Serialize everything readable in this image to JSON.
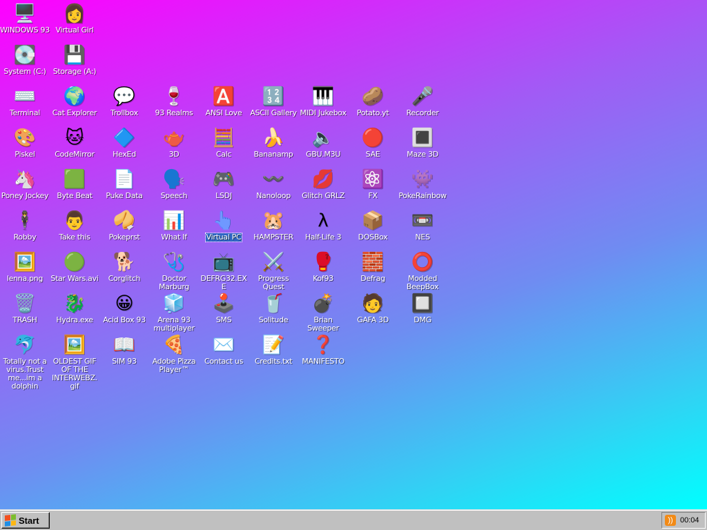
{
  "desktop": {
    "icons": [
      {
        "label": "WINDOWS 93",
        "glyph": "🖥️",
        "icon": "computer-icon",
        "col": 0,
        "row": 0
      },
      {
        "label": "Virtual Girl",
        "glyph": "👩",
        "icon": "virtual-girl-icon",
        "col": 1,
        "row": 0
      },
      {
        "label": "System (C:)",
        "glyph": "💽",
        "icon": "hard-drive-icon",
        "col": 0,
        "row": 1
      },
      {
        "label": "Storage (A:)",
        "glyph": "💾",
        "icon": "floppy-drive-icon",
        "col": 1,
        "row": 1
      },
      {
        "label": "Terminal",
        "glyph": "⌨️",
        "icon": "terminal-icon",
        "col": 0,
        "row": 2
      },
      {
        "label": "Cat Explorer",
        "glyph": "🌍",
        "icon": "cat-explorer-icon",
        "col": 1,
        "row": 2
      },
      {
        "label": "Trollbox",
        "glyph": "💬",
        "icon": "trollbox-icon",
        "col": 2,
        "row": 2
      },
      {
        "label": "93 Realms",
        "glyph": "🍷",
        "icon": "realms-icon",
        "col": 3,
        "row": 2
      },
      {
        "label": "ANSI Love",
        "glyph": "🅰️",
        "icon": "ansi-love-icon",
        "col": 4,
        "row": 2
      },
      {
        "label": "ASCII Gallery",
        "glyph": "🔢",
        "icon": "ascii-gallery-icon",
        "col": 5,
        "row": 2
      },
      {
        "label": "MIDI Jukebox",
        "glyph": "🎹",
        "icon": "midi-jukebox-icon",
        "col": 6,
        "row": 2
      },
      {
        "label": "Potato.yt",
        "glyph": "🥔",
        "icon": "potato-icon",
        "col": 7,
        "row": 2
      },
      {
        "label": "Recorder",
        "glyph": "🎤",
        "icon": "microphone-icon",
        "col": 8,
        "row": 2
      },
      {
        "label": "Piskel",
        "glyph": "🎨",
        "icon": "palette-icon",
        "col": 0,
        "row": 3
      },
      {
        "label": "CodeMirror",
        "glyph": "🐱",
        "icon": "codemirror-icon",
        "col": 1,
        "row": 3
      },
      {
        "label": "HexEd",
        "glyph": "🔷",
        "icon": "hexed-icon",
        "col": 2,
        "row": 3
      },
      {
        "label": "3D",
        "glyph": "🫖",
        "icon": "teapot-icon",
        "col": 3,
        "row": 3
      },
      {
        "label": "Calc",
        "glyph": "🧮",
        "icon": "calculator-icon",
        "col": 4,
        "row": 3
      },
      {
        "label": "Bananamp",
        "glyph": "🍌",
        "icon": "banana-icon",
        "col": 5,
        "row": 3
      },
      {
        "label": "GBU.M3U",
        "glyph": "🔈",
        "icon": "playlist-icon",
        "col": 6,
        "row": 3
      },
      {
        "label": "SAE",
        "glyph": "🔴",
        "icon": "sae-ball-icon",
        "col": 7,
        "row": 3
      },
      {
        "label": "Maze 3D",
        "glyph": "🔳",
        "icon": "maze-icon",
        "col": 8,
        "row": 3
      },
      {
        "label": "Poney Jockey",
        "glyph": "🦄",
        "icon": "pony-icon",
        "col": 0,
        "row": 4
      },
      {
        "label": "Byte Beat",
        "glyph": "🟩",
        "icon": "byte-beat-icon",
        "col": 1,
        "row": 4
      },
      {
        "label": "Puke Data",
        "glyph": "📄",
        "icon": "puke-data-icon",
        "col": 2,
        "row": 4
      },
      {
        "label": "Speech",
        "glyph": "🗣️",
        "icon": "speech-icon",
        "col": 3,
        "row": 4
      },
      {
        "label": "LSDJ",
        "glyph": "🎮",
        "icon": "lsdj-icon",
        "col": 4,
        "row": 4
      },
      {
        "label": "Nanoloop",
        "glyph": "〰️",
        "icon": "nanoloop-icon",
        "col": 5,
        "row": 4
      },
      {
        "label": "Glitch GRLZ",
        "glyph": "💋",
        "icon": "lips-icon",
        "col": 6,
        "row": 4
      },
      {
        "label": "FX",
        "glyph": "⚛️",
        "icon": "atom-icon",
        "col": 7,
        "row": 4
      },
      {
        "label": "PokeRainbow",
        "glyph": "👾",
        "icon": "pokerainbow-icon",
        "col": 8,
        "row": 4
      },
      {
        "label": "Robby",
        "glyph": "🕴️",
        "icon": "robby-icon",
        "col": 0,
        "row": 5
      },
      {
        "label": "Take this",
        "glyph": "👨",
        "icon": "take-this-icon",
        "col": 1,
        "row": 5
      },
      {
        "label": "Pokeprst",
        "glyph": "🥠",
        "icon": "pokeprst-icon",
        "col": 2,
        "row": 5
      },
      {
        "label": "What If",
        "glyph": "📊",
        "icon": "what-if-icon",
        "col": 3,
        "row": 5
      },
      {
        "label": "Virtual PC",
        "glyph": "👆",
        "icon": "virtual-pc-icon",
        "col": 4,
        "row": 5,
        "selected": true
      },
      {
        "label": "HAMPSTER",
        "glyph": "🐹",
        "icon": "hampster-icon",
        "col": 5,
        "row": 5
      },
      {
        "label": "Half-Life 3",
        "glyph": "λ",
        "icon": "half-life-icon",
        "col": 6,
        "row": 5
      },
      {
        "label": "DOSBox",
        "glyph": "📦",
        "icon": "dosbox-icon",
        "col": 7,
        "row": 5
      },
      {
        "label": "NES",
        "glyph": "📼",
        "icon": "nes-console-icon",
        "col": 8,
        "row": 5
      },
      {
        "label": "lenna.png",
        "glyph": "🖼️",
        "icon": "image-file-icon",
        "col": 0,
        "row": 6
      },
      {
        "label": "Star Wars.avi",
        "glyph": "🟢",
        "icon": "yoda-icon",
        "col": 1,
        "row": 6
      },
      {
        "label": "Corglitch",
        "glyph": "🐕",
        "icon": "corgi-icon",
        "col": 2,
        "row": 6
      },
      {
        "label": "Doctor Marburg",
        "glyph": "🩺",
        "icon": "doctor-icon",
        "col": 3,
        "row": 6
      },
      {
        "label": "DEFRG32.EXE",
        "glyph": "📺",
        "icon": "defrag-exe-icon",
        "col": 4,
        "row": 6
      },
      {
        "label": "Progress Quest",
        "glyph": "⚔️",
        "icon": "swords-icon",
        "col": 5,
        "row": 6
      },
      {
        "label": "Kof93",
        "glyph": "🥊",
        "icon": "fighter-icon",
        "col": 6,
        "row": 6
      },
      {
        "label": "Defrag",
        "glyph": "🧱",
        "icon": "defrag-icon",
        "col": 7,
        "row": 6
      },
      {
        "label": "Modded BeepBox",
        "glyph": "⭕",
        "icon": "beepbox-icon",
        "col": 8,
        "row": 6
      },
      {
        "label": "TRASH",
        "glyph": "🗑️",
        "icon": "trash-icon",
        "col": 0,
        "row": 7
      },
      {
        "label": "Hydra.exe",
        "glyph": "🐉",
        "icon": "hydra-icon",
        "col": 1,
        "row": 7
      },
      {
        "label": "Acid Box 93",
        "glyph": "😀",
        "icon": "smiley-icon",
        "col": 2,
        "row": 7
      },
      {
        "label": "Arena 93 multiplayer",
        "glyph": "🧊",
        "icon": "cube-icon",
        "col": 3,
        "row": 7
      },
      {
        "label": "SMS",
        "glyph": "🕹️",
        "icon": "sms-console-icon",
        "col": 4,
        "row": 7
      },
      {
        "label": "Solitude",
        "glyph": "🥤",
        "icon": "solitude-icon",
        "col": 5,
        "row": 7
      },
      {
        "label": "Brian Sweeper",
        "glyph": "💣",
        "icon": "mine-icon",
        "col": 6,
        "row": 7
      },
      {
        "label": "GAFA 3D",
        "glyph": "🧑",
        "icon": "gafa-face-icon",
        "col": 7,
        "row": 7
      },
      {
        "label": "DMG",
        "glyph": "🔲",
        "icon": "gameboy-icon",
        "col": 8,
        "row": 7
      },
      {
        "label": "Totally not a virus.Trust me...im a dolphin",
        "glyph": "🐬",
        "icon": "dolphin-icon",
        "col": 0,
        "row": 8
      },
      {
        "label": "OLDEST GIF OF THE INTERWEBZ.gif",
        "glyph": "🖼️",
        "icon": "gif-file-icon",
        "col": 1,
        "row": 8
      },
      {
        "label": "SIM 93",
        "glyph": "📖",
        "icon": "sim-book-icon",
        "col": 2,
        "row": 8
      },
      {
        "label": "Adobe Pizza Player™",
        "glyph": "🍕",
        "icon": "pizza-icon",
        "col": 3,
        "row": 8
      },
      {
        "label": "Contact us",
        "glyph": "✉️",
        "icon": "contact-icon",
        "col": 4,
        "row": 8
      },
      {
        "label": "Credits.txt",
        "glyph": "📝",
        "icon": "text-file-icon",
        "col": 5,
        "row": 8
      },
      {
        "label": "MANIFESTO",
        "glyph": "❓",
        "icon": "question-mark-icon",
        "col": 6,
        "row": 8
      }
    ]
  },
  "taskbar": {
    "start_label": "Start",
    "clock": "00:04",
    "tray_icon_glyph": "))"
  },
  "colors": {
    "gradient_start": "#ff00ff",
    "gradient_end": "#00ffff",
    "taskbar": "#c0c0c0",
    "selection": "#3068c4"
  }
}
